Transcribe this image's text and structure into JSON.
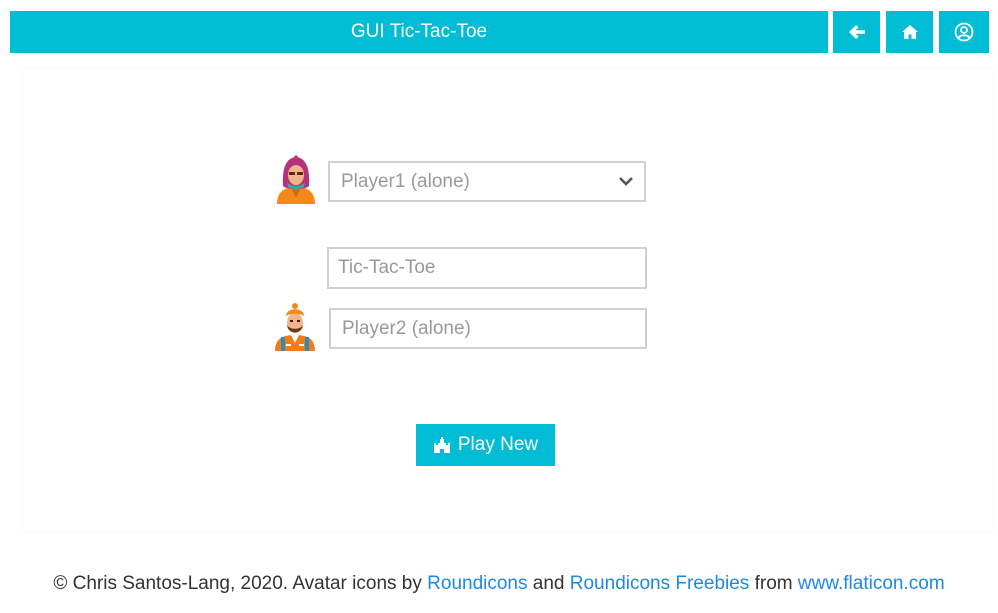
{
  "header": {
    "title": "GUI Tic-Tac-Toe",
    "accent_color": "#00bcd4",
    "buttons": [
      {
        "icon": "arrow-left-icon"
      },
      {
        "icon": "home-icon"
      },
      {
        "icon": "user-circle-icon"
      }
    ]
  },
  "players": {
    "player1": {
      "avatar": "hooded-person-avatar",
      "selected": "Player1 (alone)"
    },
    "game": {
      "value": "Tic-Tac-Toe"
    },
    "player2": {
      "avatar": "turban-person-avatar",
      "value": "Player2 (alone)"
    }
  },
  "actions": {
    "play_label": "Play New",
    "play_icon": "castle-icon"
  },
  "footer": {
    "prefix": "© Chris Santos-Lang, 2020. Avatar icons by ",
    "link1": "Roundicons",
    "and": " and ",
    "link2": "Roundicons Freebies",
    "from": " from ",
    "link3": "www.flaticon.com",
    "link_color": "#1e88e5"
  }
}
